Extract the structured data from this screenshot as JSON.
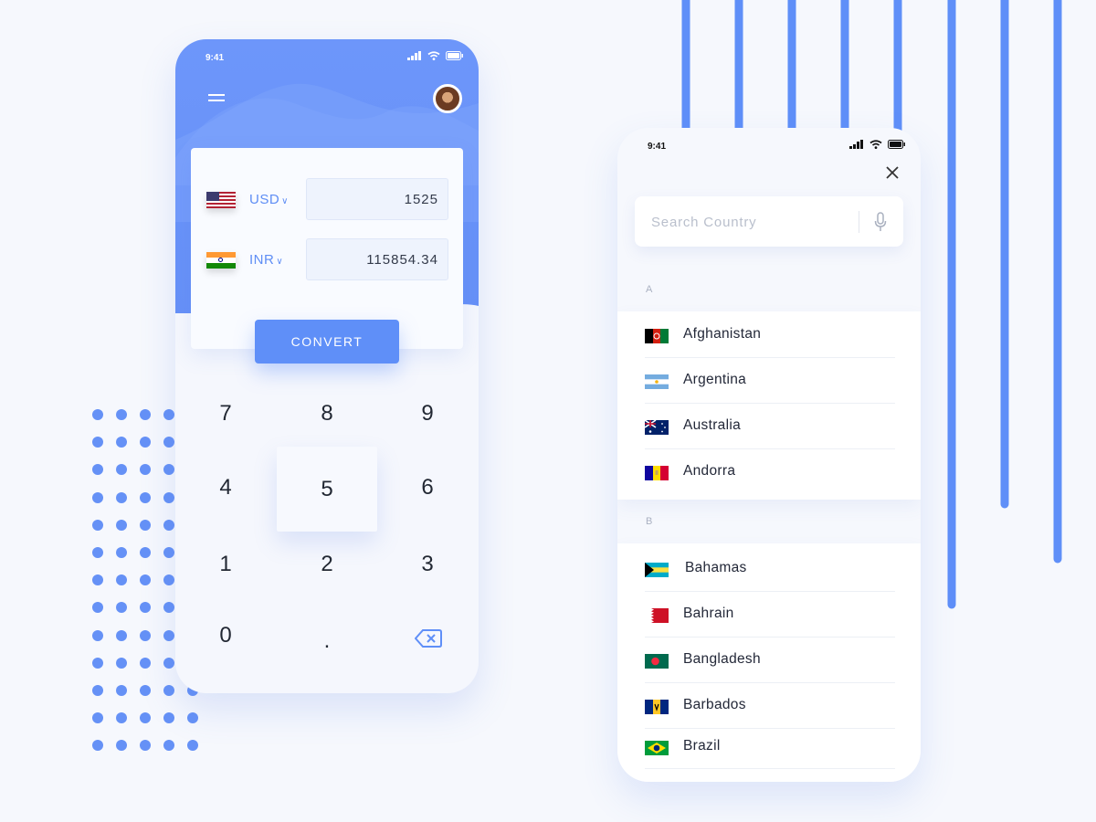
{
  "colors": {
    "accent": "#5f8ff8",
    "background": "#f6f8fd",
    "deco": "#6591f6"
  },
  "converter": {
    "status_time": "9:41",
    "from": {
      "code": "USD",
      "amount": "1525",
      "flag": "us-flag-icon"
    },
    "to": {
      "code": "INR",
      "amount": "115854.34",
      "flag": "india-flag-icon"
    },
    "convert_label": "CONVERT",
    "keypad": [
      "7",
      "8",
      "9",
      "4",
      "5",
      "6",
      "1",
      "2",
      "3",
      "0",
      ".",
      "backspace-icon"
    ],
    "pressed_key": "5"
  },
  "country_picker": {
    "status_time": "9:41",
    "search_placeholder": "Search Country",
    "sections": [
      {
        "letter": "A",
        "countries": [
          "Afghanistan",
          "Argentina",
          "Australia",
          "Andorra"
        ]
      },
      {
        "letter": "B",
        "countries": [
          "Bahamas",
          "Bahrain",
          "Bangladesh",
          "Barbados",
          "Brazil"
        ]
      }
    ]
  }
}
